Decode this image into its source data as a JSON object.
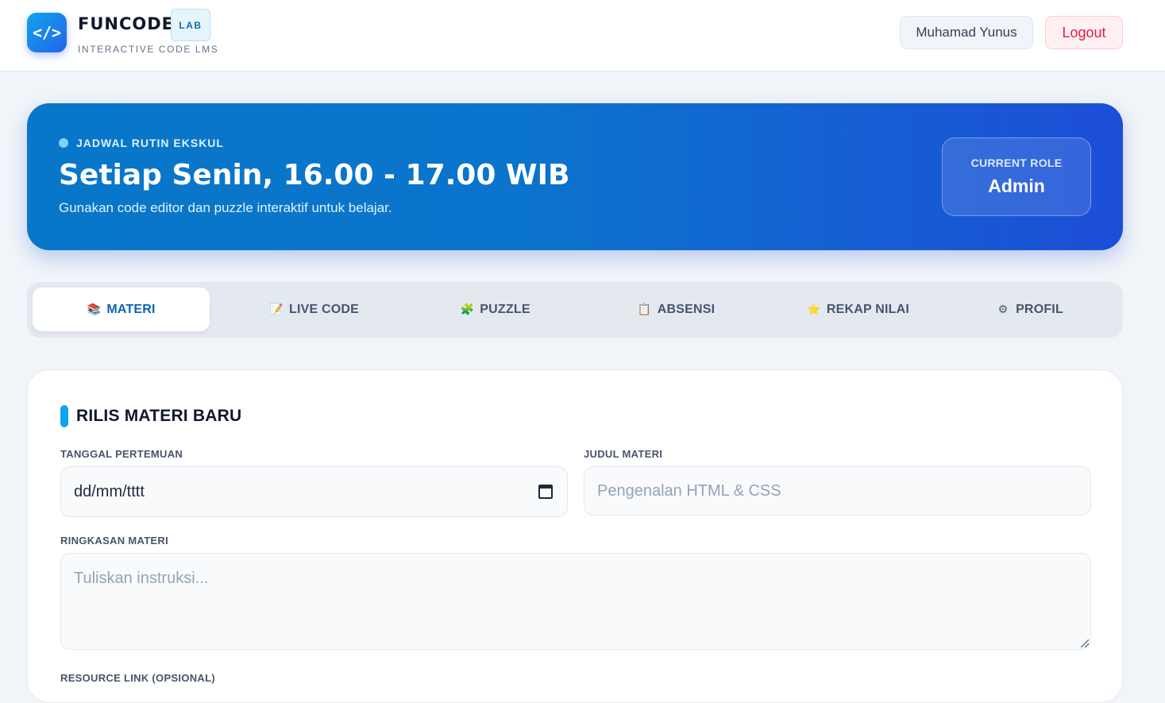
{
  "header": {
    "logo_glyph": "</>",
    "brand_name": "FUNCODE",
    "brand_badge": "LAB",
    "brand_sub": "INTERACTIVE CODE LMS",
    "user_name": "Muhamad Yunus",
    "logout_label": "Logout"
  },
  "banner": {
    "kicker": "JADWAL RUTIN EKSKUL",
    "title": "Setiap Senin, 16.00 - 17.00 WIB",
    "description": "Gunakan code editor dan puzzle interaktif untuk belajar.",
    "role_label": "CURRENT ROLE",
    "role_value": "Admin"
  },
  "tabs": [
    {
      "label": "MATERI",
      "icon": "books-icon",
      "glyph": "📚",
      "active": true
    },
    {
      "label": "LIVE CODE",
      "icon": "memo-icon",
      "glyph": "📝",
      "active": false
    },
    {
      "label": "PUZZLE",
      "icon": "puzzle-icon",
      "glyph": "🧩",
      "active": false
    },
    {
      "label": "ABSENSI",
      "icon": "clipboard-icon",
      "glyph": "📋",
      "active": false
    },
    {
      "label": "REKAP NILAI",
      "icon": "star-icon",
      "glyph": "⭐",
      "active": false
    },
    {
      "label": "PROFIL",
      "icon": "gear-icon",
      "glyph": "⚙",
      "active": false
    }
  ],
  "form": {
    "title": "RILIS MATERI BARU",
    "date_label": "TANGGAL PERTEMUAN",
    "date_value": "dd/mm/tttt",
    "title_label": "JUDUL MATERI",
    "title_placeholder": "Pengenalan HTML & CSS",
    "summary_label": "RINGKASAN MATERI",
    "summary_placeholder": "Tuliskan instruksi...",
    "resource_label": "RESOURCE LINK (OPSIONAL)"
  },
  "colors": {
    "accent": "#0ea5e9",
    "primary": "#1d4ed8",
    "danger": "#e11d48"
  }
}
